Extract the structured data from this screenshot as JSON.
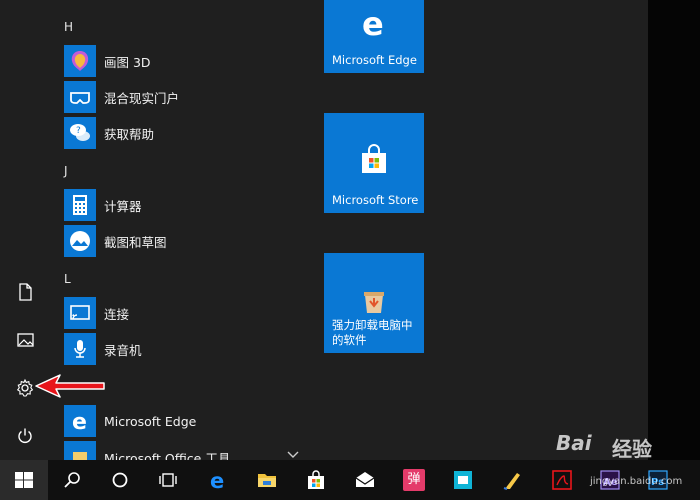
{
  "start_menu": {
    "groups": [
      {
        "letter": "H",
        "apps": [
          {
            "label": "画图 3D",
            "icon": "paint-3d-icon"
          },
          {
            "label": "混合现实门户",
            "icon": "mixed-reality-icon"
          },
          {
            "label": "获取帮助",
            "icon": "get-help-icon"
          }
        ]
      },
      {
        "letter": "J",
        "apps": [
          {
            "label": "计算器",
            "icon": "calculator-icon"
          },
          {
            "label": "截图和草图",
            "icon": "snip-sketch-icon"
          }
        ]
      },
      {
        "letter": "L",
        "apps": [
          {
            "label": "连接",
            "icon": "connect-icon"
          },
          {
            "label": "录音机",
            "icon": "voice-recorder-icon"
          }
        ]
      },
      {
        "letter": "",
        "apps": [
          {
            "label": "Microsoft Edge",
            "icon": "edge-icon"
          },
          {
            "label": "Microsoft Office 工具",
            "icon": "folder-icon"
          }
        ]
      }
    ],
    "tiles": [
      {
        "label": "Microsoft Edge",
        "icon": "edge-icon"
      },
      {
        "label": "Microsoft Store",
        "icon": "store-icon"
      },
      {
        "label": "强力卸载电脑中的软件",
        "icon": "uninstall-icon"
      }
    ],
    "rail": [
      "document-icon",
      "pictures-icon",
      "settings-icon",
      "power-icon"
    ]
  },
  "taskbar": {
    "icons": [
      "windows-start-icon",
      "search-icon",
      "cortana-icon",
      "task-view-icon",
      "edge-icon",
      "file-explorer-icon",
      "store-icon",
      "mail-icon",
      "danmaku-app-icon",
      "app-icon",
      "app-icon",
      "acrobat-icon",
      "premiere-icon",
      "photoshop-icon"
    ],
    "danmaku_label": "弹"
  },
  "watermark": {
    "brand": "Bai",
    "suffix": "经验",
    "url": "jingyan.baidu.com"
  },
  "colors": {
    "accent": "#0a78d4",
    "background": "#1f1f1f",
    "taskbar": "#101010",
    "arrow": "#e8151b"
  }
}
